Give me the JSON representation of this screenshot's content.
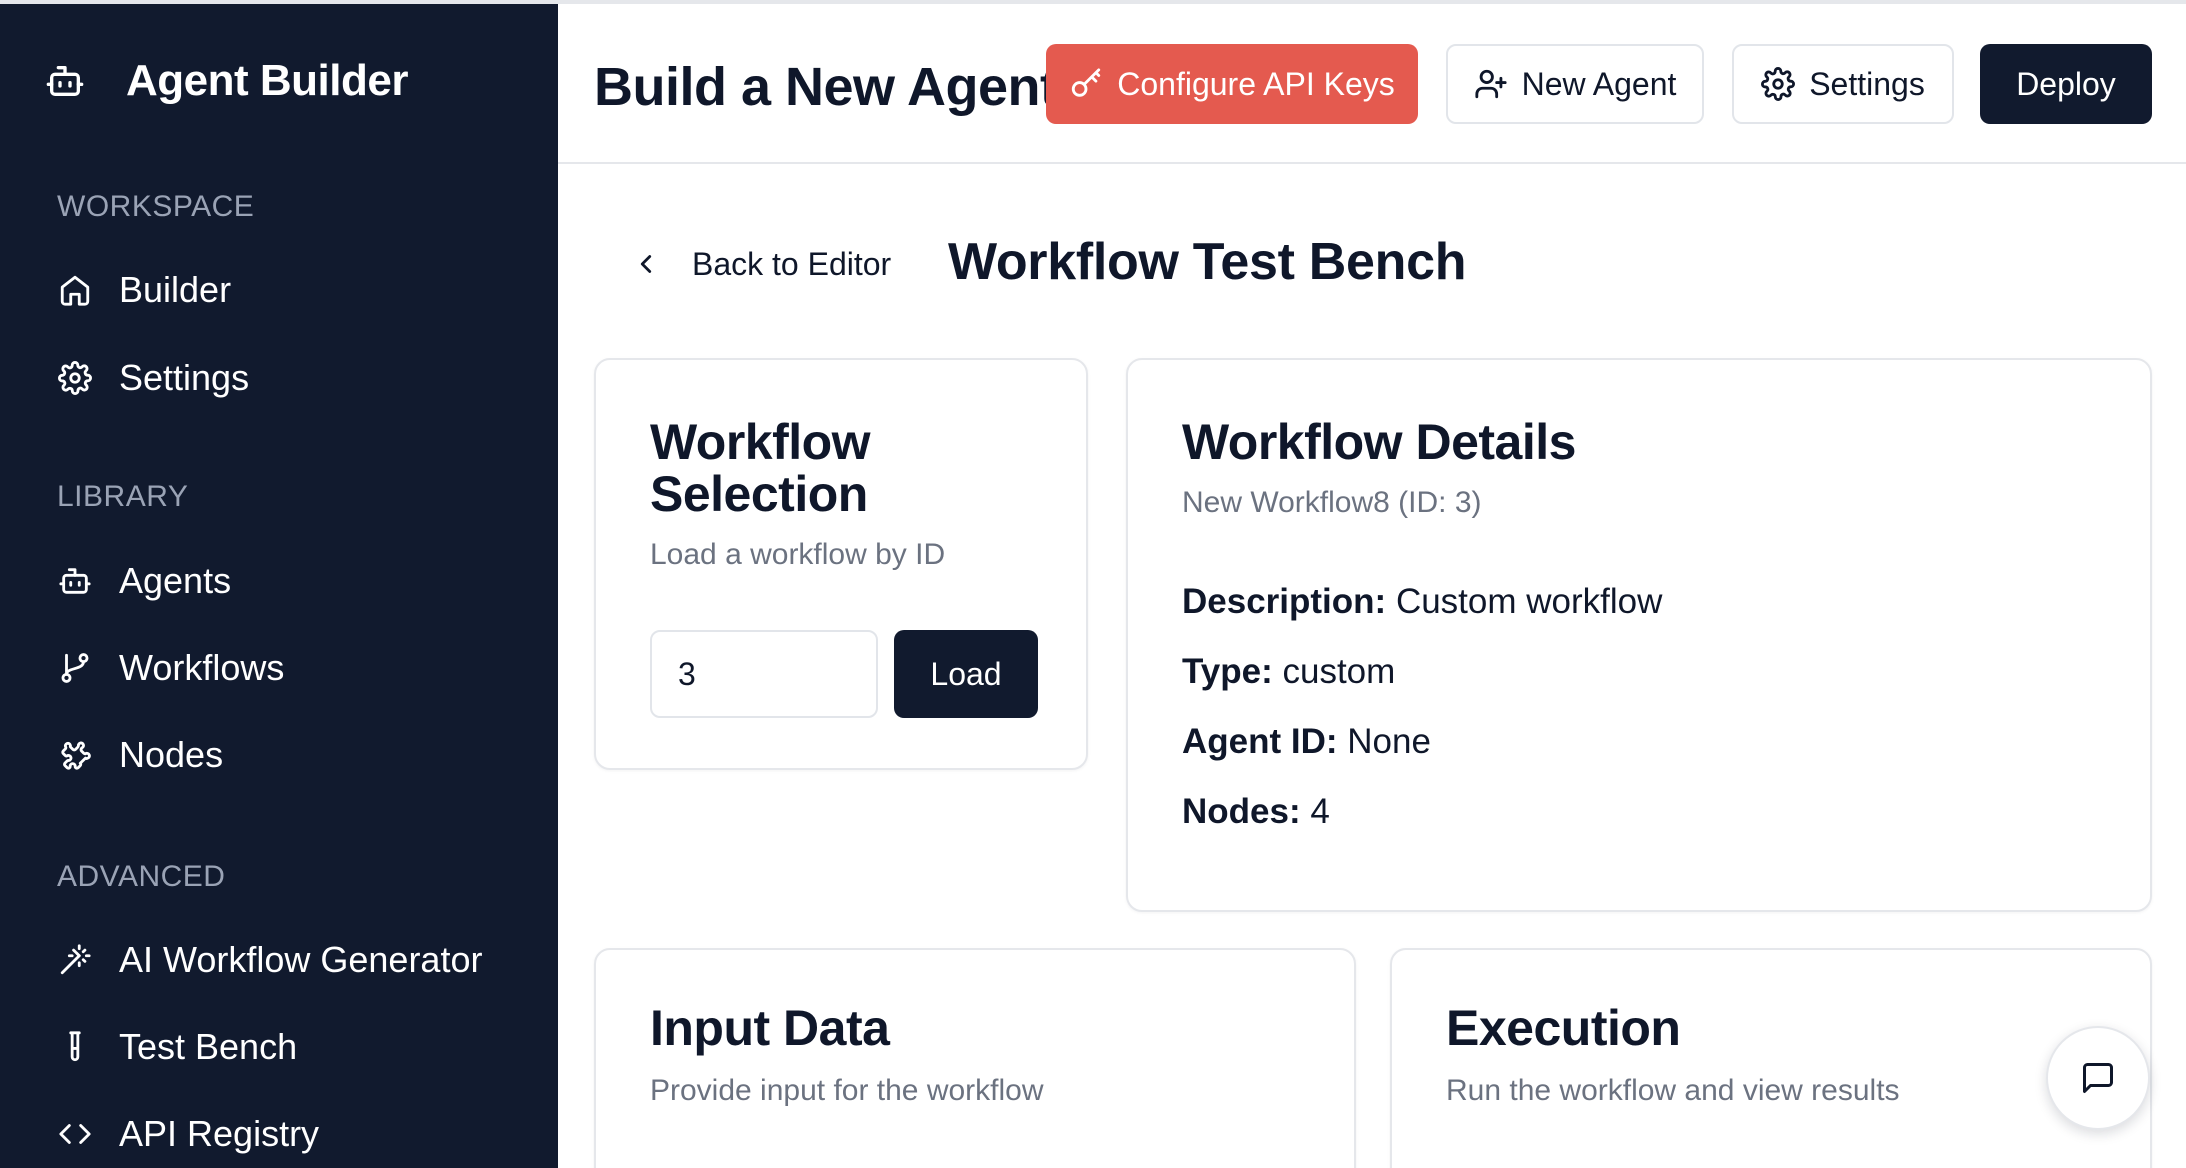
{
  "sidebar": {
    "brand": "Agent Builder",
    "sections": [
      {
        "label": "WORKSPACE",
        "items": [
          {
            "label": "Builder",
            "icon": "home-icon"
          },
          {
            "label": "Settings",
            "icon": "gear-icon"
          }
        ]
      },
      {
        "label": "LIBRARY",
        "items": [
          {
            "label": "Agents",
            "icon": "bot-icon"
          },
          {
            "label": "Workflows",
            "icon": "git-branch-icon"
          },
          {
            "label": "Nodes",
            "icon": "puzzle-icon"
          }
        ]
      },
      {
        "label": "ADVANCED",
        "items": [
          {
            "label": "AI Workflow Generator",
            "icon": "magic-wand-icon"
          },
          {
            "label": "Test Bench",
            "icon": "test-tube-icon"
          },
          {
            "label": "API Registry",
            "icon": "code-icon"
          }
        ]
      }
    ]
  },
  "header": {
    "title": "Build a New Agent",
    "configure_api_keys": "Configure API Keys",
    "new_agent": "New Agent",
    "settings": "Settings",
    "deploy": "Deploy"
  },
  "main": {
    "back_label": "Back to Editor",
    "title": "Workflow Test Bench",
    "selection": {
      "title_line1": "Workflow",
      "title_line2": "Selection",
      "subtitle": "Load a workflow by ID",
      "id_value": "3",
      "load_label": "Load"
    },
    "details": {
      "title": "Workflow Details",
      "subtitle": "New Workflow8 (ID: 3)",
      "description_label": "Description:",
      "description_value": "Custom workflow",
      "type_label": "Type:",
      "type_value": "custom",
      "agent_id_label": "Agent ID:",
      "agent_id_value": "None",
      "nodes_label": "Nodes:",
      "nodes_value": "4"
    },
    "input_card": {
      "title": "Input Data",
      "subtitle": "Provide input for the workflow"
    },
    "execution_card": {
      "title": "Execution",
      "subtitle": "Run the workflow and view results"
    }
  },
  "colors": {
    "sidebar_bg": "#111a2e",
    "accent_red": "#e45a4f",
    "primary_dark": "#111a2e"
  }
}
